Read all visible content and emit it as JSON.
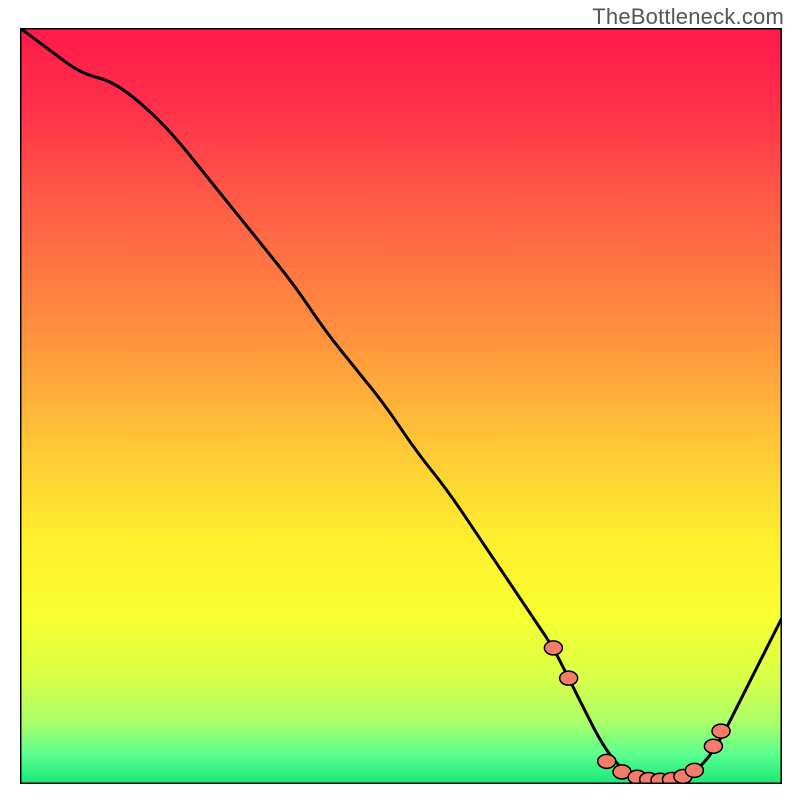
{
  "watermark": "TheBottleneck.com",
  "colors": {
    "gradient_stops": [
      {
        "offset": 0.0,
        "color": "#ff1a4b"
      },
      {
        "offset": 0.1,
        "color": "#ff2f4a"
      },
      {
        "offset": 0.25,
        "color": "#ff6245"
      },
      {
        "offset": 0.4,
        "color": "#ff8f3f"
      },
      {
        "offset": 0.55,
        "color": "#ffc637"
      },
      {
        "offset": 0.68,
        "color": "#fff02e"
      },
      {
        "offset": 0.78,
        "color": "#f7ff30"
      },
      {
        "offset": 0.86,
        "color": "#d9ff48"
      },
      {
        "offset": 0.92,
        "color": "#a9ff6b"
      },
      {
        "offset": 0.96,
        "color": "#5cff8f"
      },
      {
        "offset": 1.0,
        "color": "#17e877"
      }
    ],
    "curve": "#000000",
    "frame": "#000000",
    "marker_fill": "#f47c6a",
    "marker_stroke": "#000000"
  },
  "chart_data": {
    "type": "line",
    "title": "",
    "xlabel": "",
    "ylabel": "",
    "xlim": [
      0,
      100
    ],
    "ylim": [
      0,
      100
    ],
    "series": [
      {
        "name": "bottleneck-curve",
        "x": [
          0,
          4,
          8,
          12,
          16,
          20,
          24,
          28,
          32,
          36,
          40,
          44,
          48,
          52,
          56,
          60,
          64,
          68,
          70,
          72,
          74,
          76,
          78,
          80,
          82,
          84,
          86,
          88,
          90,
          92,
          94,
          96,
          98,
          100
        ],
        "y": [
          100,
          97,
          94,
          93,
          90,
          86,
          81,
          76,
          71,
          66,
          60,
          55,
          50,
          44,
          39,
          33,
          27,
          21,
          18,
          14,
          10,
          6,
          3,
          1.2,
          0.6,
          0.4,
          0.5,
          1.2,
          3,
          6,
          10,
          14,
          18,
          22
        ]
      }
    ],
    "markers": {
      "name": "optimum-points",
      "points": [
        {
          "x": 70,
          "y": 18
        },
        {
          "x": 72,
          "y": 14
        },
        {
          "x": 77,
          "y": 3
        },
        {
          "x": 79,
          "y": 1.6
        },
        {
          "x": 81,
          "y": 0.9
        },
        {
          "x": 82.5,
          "y": 0.6
        },
        {
          "x": 84,
          "y": 0.5
        },
        {
          "x": 85.5,
          "y": 0.6
        },
        {
          "x": 87,
          "y": 1.0
        },
        {
          "x": 88.5,
          "y": 1.8
        },
        {
          "x": 91,
          "y": 5
        },
        {
          "x": 92,
          "y": 7
        }
      ]
    }
  }
}
